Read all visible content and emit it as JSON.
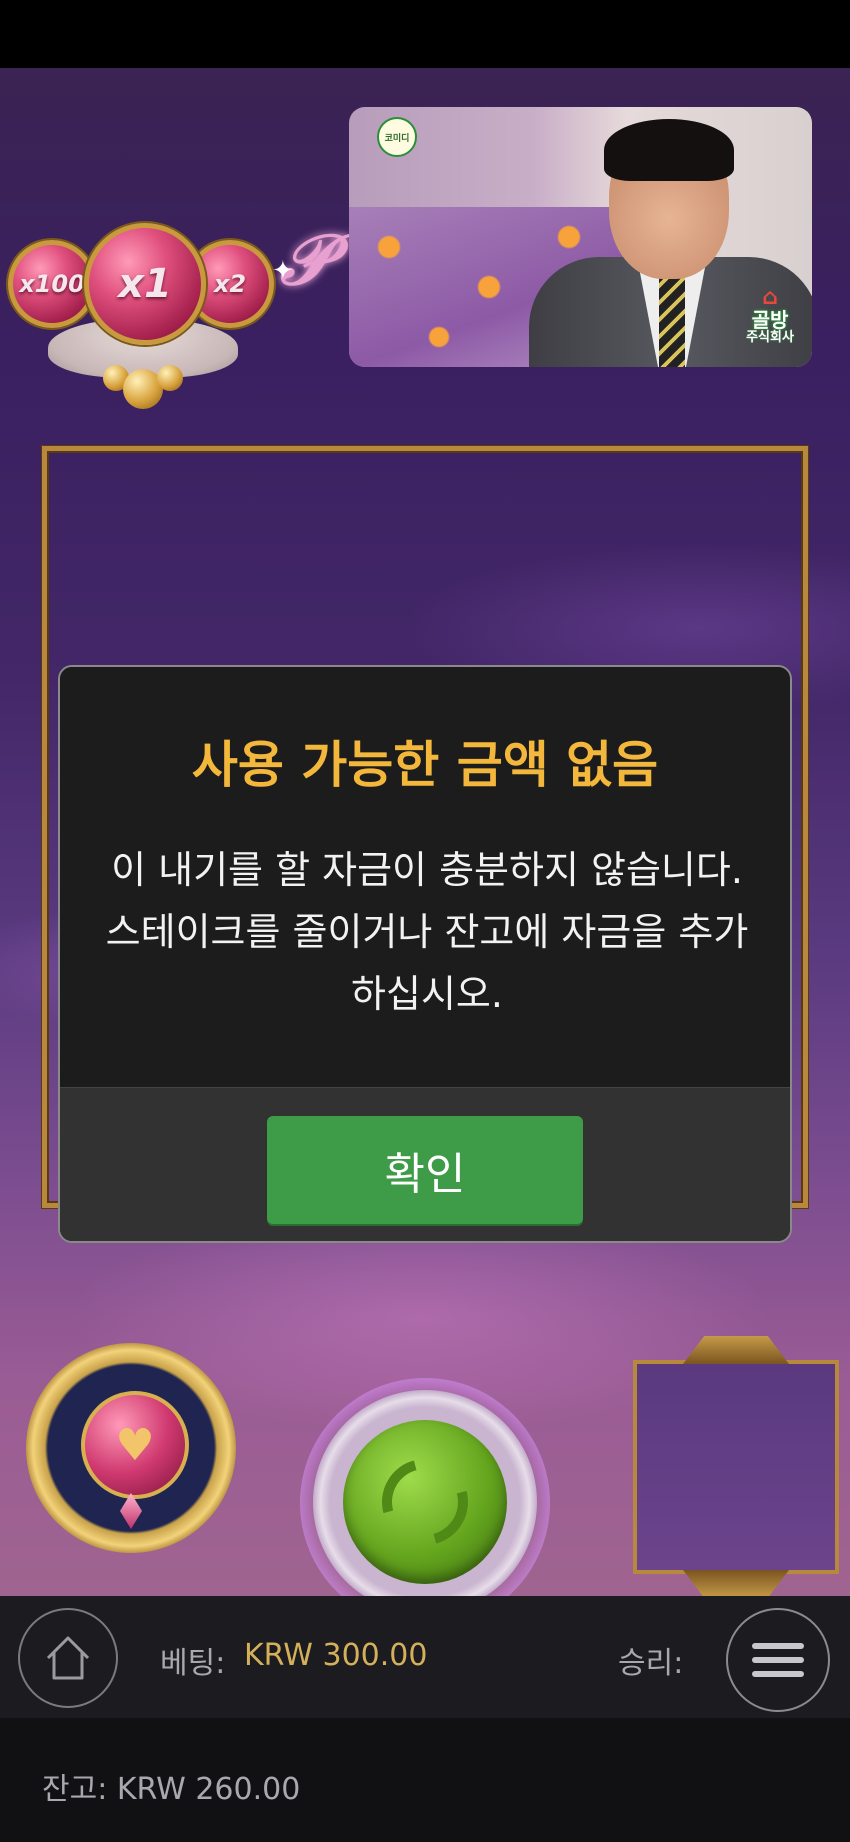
{
  "multipliers": {
    "left": "x100",
    "center": "x1",
    "right": "x2"
  },
  "video_overlay": {
    "channel_logo": "코미디",
    "watermark_title": "골방",
    "watermark_subtitle": "주식회사"
  },
  "dialog": {
    "title": "사용 가능한 금액 없음",
    "message": "이 내기를 할 자금이 충분하지 않습니다. 스테이크를 줄이거나 잔고에 자금을 추가하십시오.",
    "confirm_label": "확인"
  },
  "bottom_bar": {
    "bet_label": "베팅:",
    "bet_value": "KRW 300.00",
    "win_label": "승리:",
    "balance_text": "잔고: KRW 260.00"
  },
  "colors": {
    "dialog_title": "#f3b73c",
    "confirm_button": "#3e9b47",
    "bet_value": "#d5b05a"
  },
  "icons": {
    "home": "home-icon",
    "menu": "menu-icon",
    "spin": "spin-icon",
    "autoplay": "heart-icon"
  }
}
